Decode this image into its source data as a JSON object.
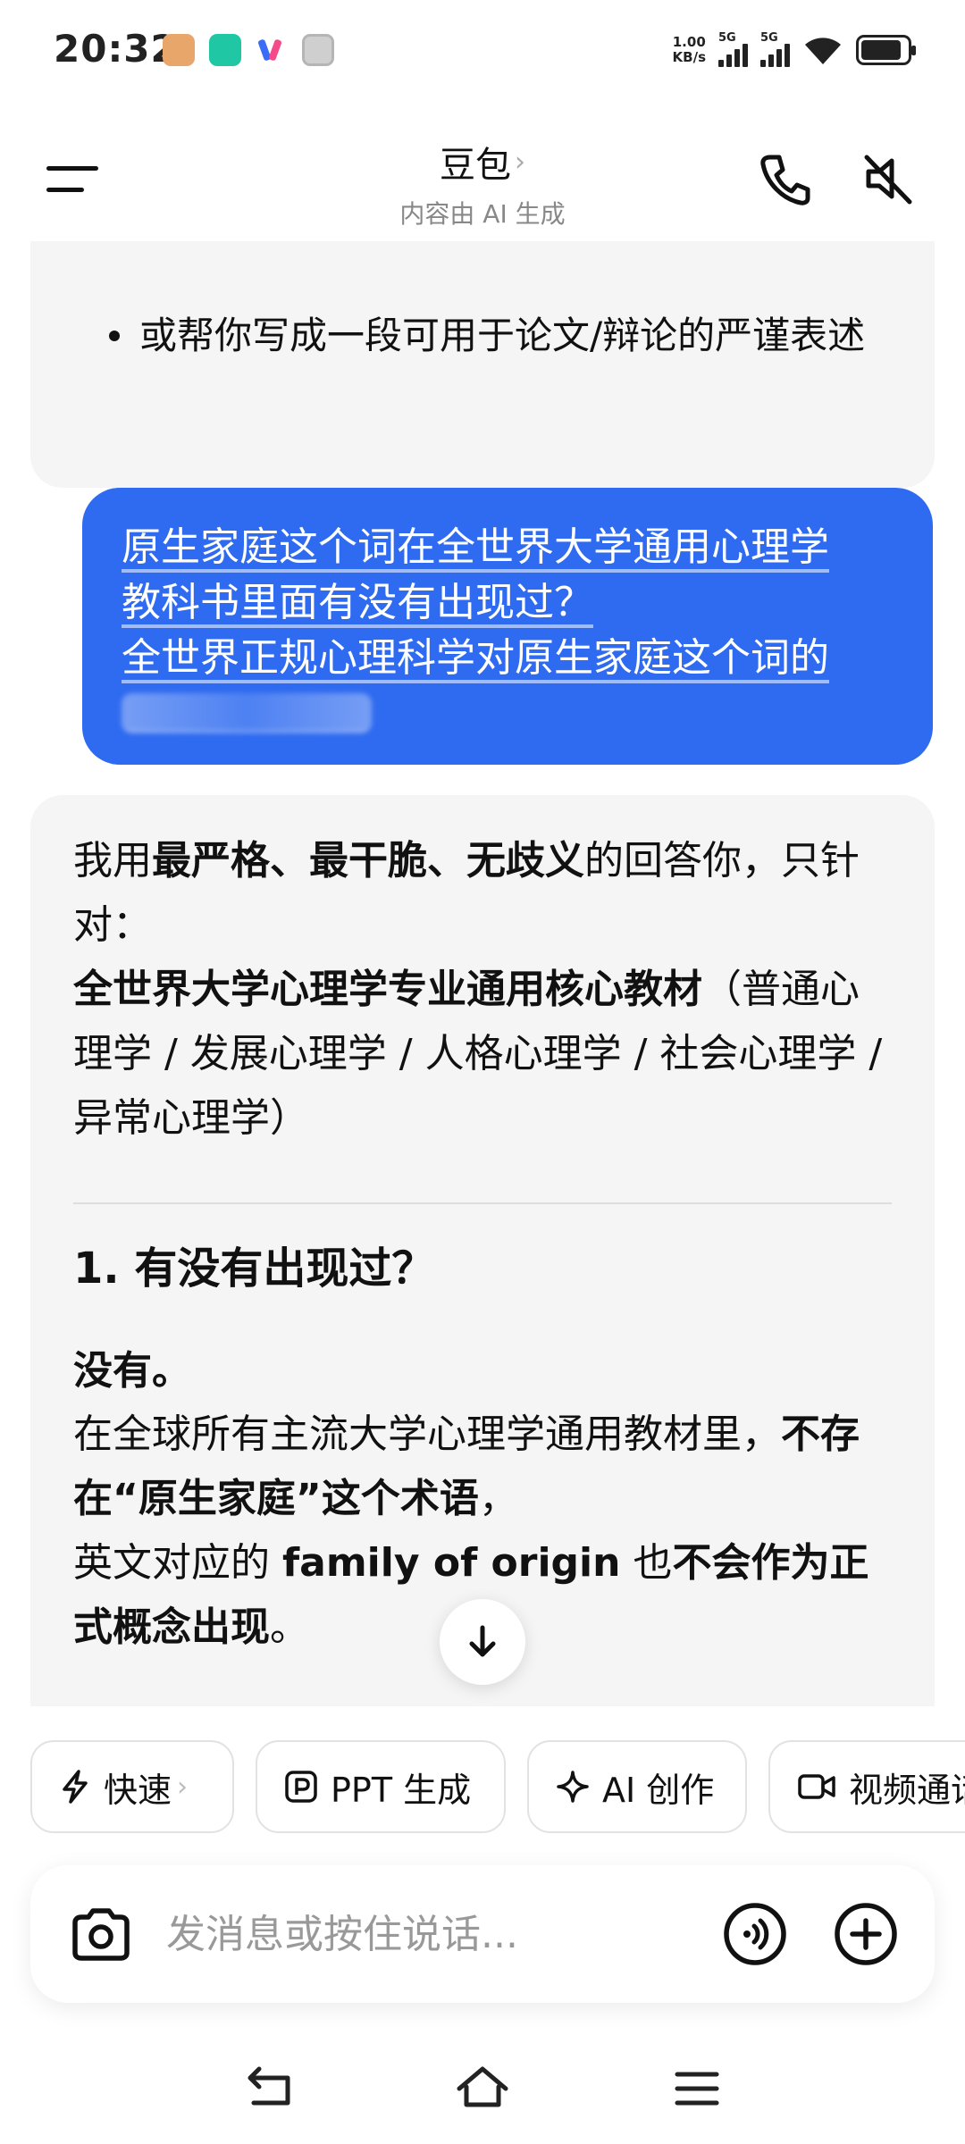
{
  "status_bar": {
    "time": "20:32",
    "net_speed_value": "1.00",
    "net_speed_unit": "KB/s",
    "sim1_label": "5G",
    "sim2_label": "5G",
    "icons": [
      "app-notification-icon",
      "app-notification-icon",
      "app-notification-icon",
      "settings-notification-icon",
      "wifi-icon",
      "battery-icon"
    ]
  },
  "header": {
    "title": "豆包",
    "title_chevron": "›",
    "subtitle": "内容由 AI 生成",
    "icons": [
      "menu-icon",
      "phone-icon",
      "mute-icon"
    ]
  },
  "chat": {
    "prev_ai_bullet": "或帮你写成一段可用于论文/辩论的严谨表述",
    "user_message": {
      "line1": "原生家庭这个词在全世界大学通用心理学",
      "line2": "教科书里面有没有出现过？",
      "line3": "全世界正规心理科学对原生家庭这个词的"
    },
    "ai_reply": {
      "p1_a": "我用",
      "p1_b": "最严格、最干脆、无歧义",
      "p1_c": "的回答你，只针对：",
      "p2_b": "全世界大学心理学专业通用核心教材",
      "p2_c": "（普通心理学 / 发展心理学 / 人格心理学 / 社会心理学 / 异常心理学）",
      "heading": "1. 有没有出现过？",
      "answer": "没有。",
      "p3_a": "在全球所有主流大学心理学通用教材里，",
      "p3_b": "不存在“原生家庭”这个术语",
      "p3_c": "，",
      "p4_a": "英文对应的 ",
      "p4_b": "family of origin",
      "p4_c": " 也",
      "p4_d": "不会作为正式概念出现",
      "p4_e": "。"
    }
  },
  "quick_actions": [
    {
      "label": "快速",
      "icon": "lightning-icon",
      "chevron": "›"
    },
    {
      "label": "PPT 生成",
      "icon": "ppt-icon"
    },
    {
      "label": "AI 创作",
      "icon": "sparkle-icon"
    },
    {
      "label": "视频通话",
      "icon": "video-icon"
    }
  ],
  "composer": {
    "placeholder": "发消息或按住说话...",
    "icons": [
      "camera-icon",
      "voice-icon",
      "plus-icon"
    ]
  },
  "navbar": {
    "icons": [
      "back-icon",
      "home-icon",
      "recents-icon"
    ]
  }
}
